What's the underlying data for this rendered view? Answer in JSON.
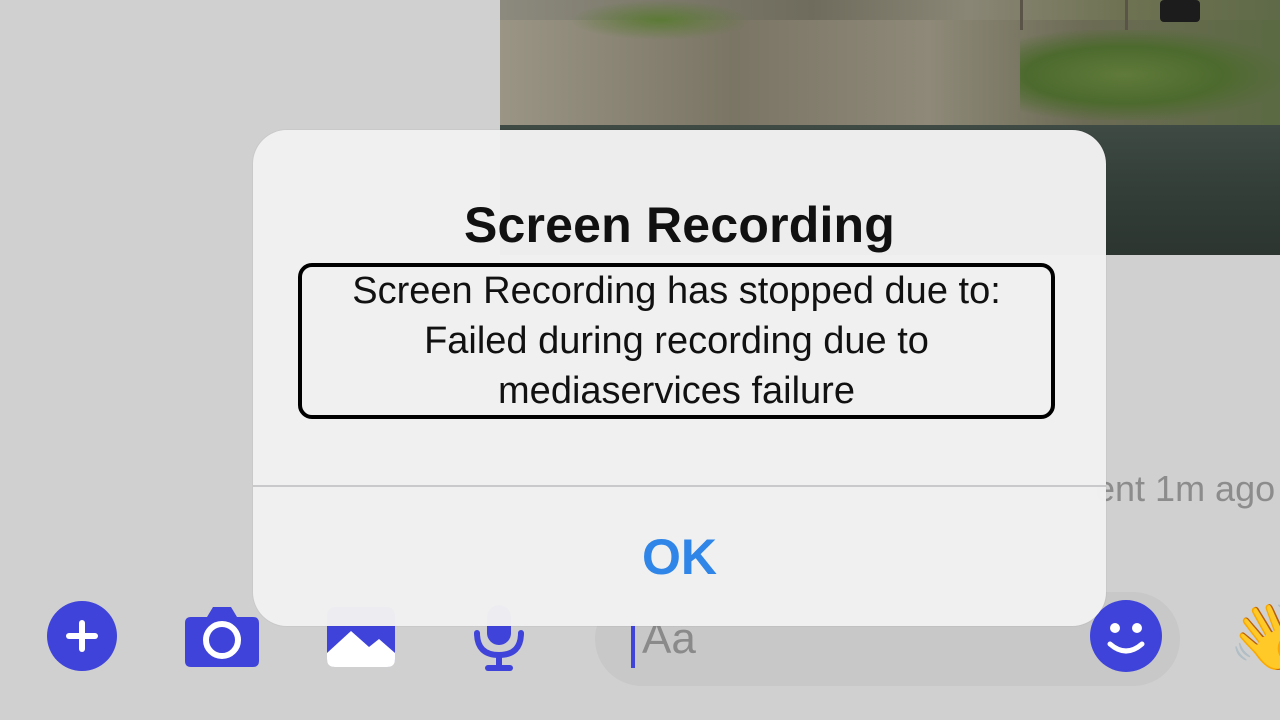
{
  "alert": {
    "title": "Screen Recording",
    "message_lines": [
      "Screen Recording has stopped due to:",
      "Failed during recording due to",
      "mediaservices failure"
    ],
    "ok_label": "OK"
  },
  "chat": {
    "timestamp": "ent 1m ago"
  },
  "composer": {
    "placeholder": "Aa",
    "icons": [
      "plus-icon",
      "camera-icon",
      "image-icon",
      "microphone-icon",
      "smiley-icon",
      "waving-hand-icon"
    ]
  },
  "colors": {
    "accent": "#3f43d9",
    "ok_blue": "#2f86e8",
    "alert_bg": "#f1f1f1",
    "background": "#d0d0d0"
  }
}
